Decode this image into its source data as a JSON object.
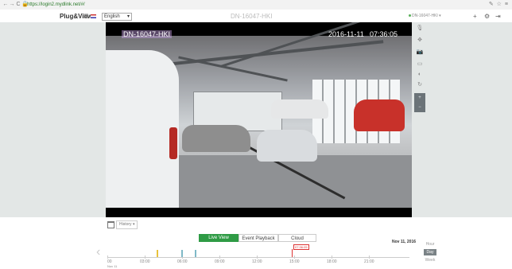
{
  "browser": {
    "url": "https://login2.mydlink.net/#/",
    "nav_icons": [
      "back-icon",
      "forward-icon",
      "reload-icon",
      "lock-icon"
    ],
    "toolbar_glyphs": "✎ ☆ ≡"
  },
  "header": {
    "brand": "Plug&View",
    "language": "English",
    "camera_title": "DN-16047-HKI",
    "status_label": "DN-16047-HKI",
    "icons": [
      "grid-icon",
      "flag-icon",
      "plus-icon",
      "settings-icon",
      "logout-icon"
    ]
  },
  "video": {
    "osd_name": "DN-16047-HKI",
    "osd_date": "2016-11-11",
    "osd_time": "07:36:05"
  },
  "side_toolbar": {
    "glyphs": [
      "🎙",
      "✥",
      "📷",
      "▭",
      "◐",
      "↻"
    ],
    "zoom_in": "+",
    "zoom_out": "−"
  },
  "controls": {
    "history_label": "History ▾",
    "tabs": [
      {
        "label": "Live View"
      },
      {
        "label": "Event Playback"
      },
      {
        "label": "Cloud"
      }
    ],
    "timeline_date": "Nov 11, 2016",
    "timeline_ticks": [
      "00",
      "03:00",
      "06:00",
      "09:00",
      "12:00",
      "15:00",
      "18:00",
      "21:00"
    ],
    "timeline_date_under": "Nov 11",
    "now_label": "07:36:05",
    "ranges": [
      "Hour",
      "Day",
      "Week"
    ]
  },
  "colors": {
    "accent_green": "#2f9b45",
    "now_red": "#d33",
    "event_yellow": "#e8c23b",
    "event_teal": "#7fb9c7"
  }
}
